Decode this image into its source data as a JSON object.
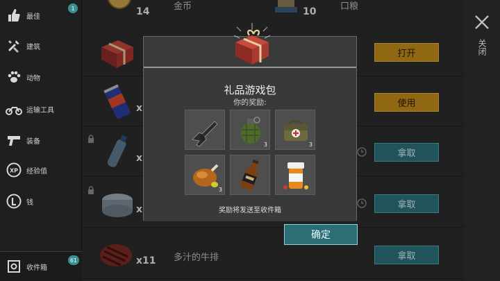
{
  "sidebar": {
    "items": [
      {
        "label": "最佳",
        "icon": "thumbs-up-icon",
        "badge": "1"
      },
      {
        "label": "建筑",
        "icon": "tools-icon"
      },
      {
        "label": "动物",
        "icon": "paw-icon"
      },
      {
        "label": "运输工具",
        "icon": "motorcycle-icon"
      },
      {
        "label": "装备",
        "icon": "pistol-icon"
      },
      {
        "label": "经验值",
        "icon": "xp-icon"
      },
      {
        "label": "钱",
        "icon": "coin-icon"
      }
    ],
    "inbox": {
      "label": "收件箱",
      "badge": "61",
      "icon": "inbox-icon"
    }
  },
  "top_row": {
    "left_qty": "14",
    "left_name": "金币",
    "right_qty": "10",
    "right_name": "口粮"
  },
  "rows": [
    {
      "item": "gift-box",
      "qty": "",
      "name": "",
      "button": "打开",
      "button_style": "gold",
      "locked": false
    },
    {
      "item": "energy-drink-can",
      "qty": "x",
      "name": "",
      "button": "使用",
      "button_style": "gold",
      "locked": false
    },
    {
      "item": "water-bottle",
      "qty": "x",
      "name": "",
      "button": "拿取",
      "button_style": "teal",
      "locked": true
    },
    {
      "item": "tuna-can",
      "qty": "x",
      "name": "",
      "button": "拿取",
      "button_style": "teal",
      "locked": true
    },
    {
      "item": "steak",
      "qty": "x11",
      "name": "多汁的牛排",
      "button": "拿取",
      "button_style": "teal",
      "locked": false
    }
  ],
  "close": {
    "label": "关闭",
    "icon": "close-icon"
  },
  "modal": {
    "title": "礼品游戏包",
    "subtitle": "你的奖励:",
    "rewards": [
      {
        "name": "assault-rifle",
        "count": ""
      },
      {
        "name": "grenade",
        "count": "3"
      },
      {
        "name": "medkit-bag",
        "count": "3"
      },
      {
        "name": "roast-chicken",
        "count": "3"
      },
      {
        "name": "whiskey-bottle",
        "count": ""
      },
      {
        "name": "pill-bottle",
        "count": ""
      }
    ],
    "note": "奖励将发送至收件箱",
    "confirm": "确定"
  },
  "colors": {
    "gold_button": "#c08a18",
    "teal_button": "#2c6f78",
    "badge": "#3a8f8f"
  }
}
